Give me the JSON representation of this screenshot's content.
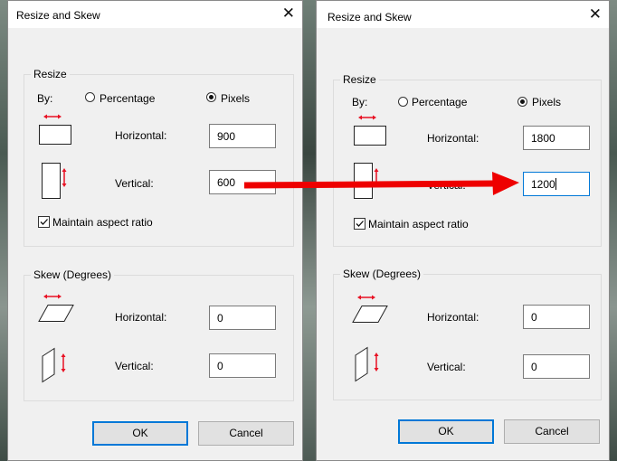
{
  "dialogs": [
    {
      "title": "Resize and Skew",
      "resize": {
        "group_label": "Resize",
        "by_label": "By:",
        "percentage_label": "Percentage",
        "pixels_label": "Pixels",
        "horizontal_label": "Horizontal:",
        "horizontal_value": "900",
        "vertical_label": "Vertical:",
        "vertical_value": "600",
        "maintain_label": "Maintain aspect ratio"
      },
      "skew": {
        "group_label": "Skew (Degrees)",
        "horizontal_label": "Horizontal:",
        "horizontal_value": "0",
        "vertical_label": "Vertical:",
        "vertical_value": "0"
      },
      "ok_label": "OK",
      "cancel_label": "Cancel"
    },
    {
      "title": "Resize and Skew",
      "resize": {
        "group_label": "Resize",
        "by_label": "By:",
        "percentage_label": "Percentage",
        "pixels_label": "Pixels",
        "horizontal_label": "Horizontal:",
        "horizontal_value": "1800",
        "vertical_label": "Vertical:",
        "vertical_value": "1200",
        "maintain_label": "Maintain aspect ratio"
      },
      "skew": {
        "group_label": "Skew (Degrees)",
        "horizontal_label": "Horizontal:",
        "horizontal_value": "0",
        "vertical_label": "Vertical:",
        "vertical_value": "0"
      },
      "ok_label": "OK",
      "cancel_label": "Cancel"
    }
  ],
  "colors": {
    "accent": "#0078d7",
    "arrow": "#ee0000",
    "icon_red": "#e81123"
  },
  "icons": [
    "close-icon",
    "resize-horizontal-icon",
    "resize-vertical-icon",
    "skew-horizontal-icon",
    "skew-vertical-icon",
    "annotation-arrow"
  ]
}
